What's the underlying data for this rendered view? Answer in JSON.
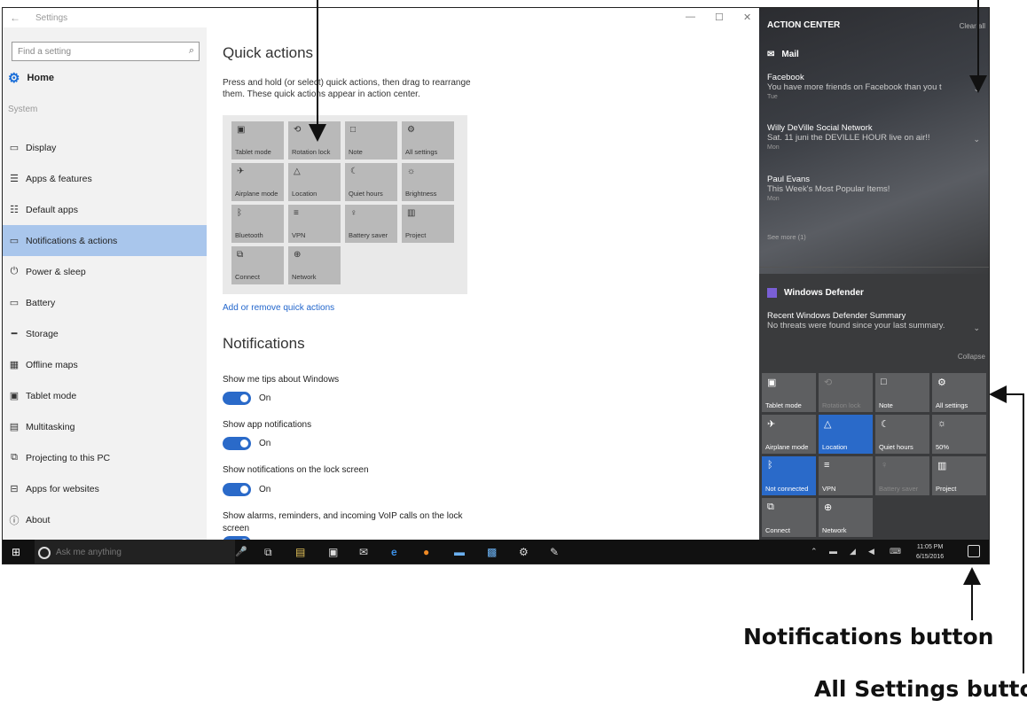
{
  "settings": {
    "window_title": "Settings",
    "back_glyph": "←",
    "window_controls": [
      "—",
      "☐",
      "✕"
    ],
    "search_placeholder": "Find a setting",
    "search_icon": "search-icon",
    "home_label": "Home",
    "group_label": "System",
    "nav": [
      {
        "label": "Display",
        "icon": "display-icon"
      },
      {
        "label": "Apps & features",
        "icon": "apps-icon"
      },
      {
        "label": "Default apps",
        "icon": "default-apps-icon"
      },
      {
        "label": "Notifications & actions",
        "icon": "notifications-icon",
        "active": true
      },
      {
        "label": "Power & sleep",
        "icon": "power-icon"
      },
      {
        "label": "Battery",
        "icon": "battery-icon"
      },
      {
        "label": "Storage",
        "icon": "storage-icon"
      },
      {
        "label": "Offline maps",
        "icon": "map-icon"
      },
      {
        "label": "Tablet mode",
        "icon": "tablet-icon"
      },
      {
        "label": "Multitasking",
        "icon": "multitasking-icon"
      },
      {
        "label": "Projecting to this PC",
        "icon": "projecting-icon"
      },
      {
        "label": "Apps for websites",
        "icon": "web-apps-icon"
      },
      {
        "label": "About",
        "icon": "info-icon"
      }
    ],
    "quick_actions_heading": "Quick actions",
    "quick_actions_desc_1": "Press and hold (or select) quick actions, then drag to rearrange",
    "quick_actions_desc_2": "them. These quick actions appear in action center.",
    "tiles": [
      {
        "label": "Tablet mode",
        "icon": "tablet-icon"
      },
      {
        "label": "Rotation lock",
        "icon": "rotation-lock-icon"
      },
      {
        "label": "Note",
        "icon": "note-icon"
      },
      {
        "label": "All settings",
        "icon": "gear-icon"
      },
      {
        "label": "Airplane mode",
        "icon": "airplane-icon"
      },
      {
        "label": "Location",
        "icon": "location-icon"
      },
      {
        "label": "Quiet hours",
        "icon": "moon-icon"
      },
      {
        "label": "Brightness",
        "icon": "brightness-icon"
      },
      {
        "label": "Bluetooth",
        "icon": "bluetooth-icon"
      },
      {
        "label": "VPN",
        "icon": "vpn-icon"
      },
      {
        "label": "Battery saver",
        "icon": "battery-saver-icon"
      },
      {
        "label": "Project",
        "icon": "project-icon"
      },
      {
        "label": "Connect",
        "icon": "connect-icon"
      },
      {
        "label": "Network",
        "icon": "network-icon"
      }
    ],
    "add_remove_link": "Add or remove quick actions",
    "notifications_heading": "Notifications",
    "options": [
      {
        "label": "Show me tips about Windows",
        "state": "On"
      },
      {
        "label": "Show app notifications",
        "state": "On"
      },
      {
        "label": "Show notifications on the lock screen",
        "state": "On"
      },
      {
        "label": "Show alarms, reminders, and incoming VoIP calls on the lock",
        "label2": "screen"
      }
    ]
  },
  "action_center": {
    "title": "ACTION CENTER",
    "clear_all": "Clear all",
    "mail_app": "Mail",
    "notifications": [
      {
        "title": "Facebook",
        "body": "You have more friends on Facebook than you t",
        "date": "Tue"
      },
      {
        "title": "Willy DeVille Social Network",
        "body": "Sat. 11 juni the DEVILLE HOUR live on air!!",
        "date": "Mon"
      },
      {
        "title": "Paul Evans",
        "body": "This Week's Most Popular Items!",
        "date": "Mon"
      }
    ],
    "see_more": "See more (1)",
    "defender_app": "Windows Defender",
    "defender_note": {
      "title": "Recent Windows Defender Summary",
      "body": "No threats were found since your last summary."
    },
    "collapse": "Collapse",
    "quick_actions": [
      {
        "label": "Tablet mode",
        "icon": "tablet-icon",
        "state": "off"
      },
      {
        "label": "Rotation lock",
        "icon": "rotation-lock-icon",
        "state": "disabled"
      },
      {
        "label": "Note",
        "icon": "note-icon",
        "state": "off"
      },
      {
        "label": "All settings",
        "icon": "gear-icon",
        "state": "off"
      },
      {
        "label": "Airplane mode",
        "icon": "airplane-icon",
        "state": "off"
      },
      {
        "label": "Location",
        "icon": "location-icon",
        "state": "on"
      },
      {
        "label": "Quiet hours",
        "icon": "moon-icon",
        "state": "off"
      },
      {
        "label": "50%",
        "icon": "brightness-icon",
        "state": "off"
      },
      {
        "label": "Not connected",
        "icon": "bluetooth-icon",
        "state": "on"
      },
      {
        "label": "VPN",
        "icon": "vpn-icon",
        "state": "off"
      },
      {
        "label": "Battery saver",
        "icon": "battery-saver-icon",
        "state": "disabled"
      },
      {
        "label": "Project",
        "icon": "project-icon",
        "state": "off"
      },
      {
        "label": "Connect",
        "icon": "connect-icon",
        "state": "off"
      },
      {
        "label": "Network",
        "icon": "network-icon",
        "state": "off"
      }
    ]
  },
  "taskbar": {
    "search_placeholder": "Ask me anything",
    "time": "11:05 PM",
    "date": "6/15/2016"
  },
  "annotations": {
    "notifications_button": "Notifications button",
    "all_settings_button": "All Settings button"
  },
  "colors": {
    "accent": "#2a6ac9",
    "nav_active": "#a9c6ec",
    "action_center_bg": "#3a3b3d"
  }
}
